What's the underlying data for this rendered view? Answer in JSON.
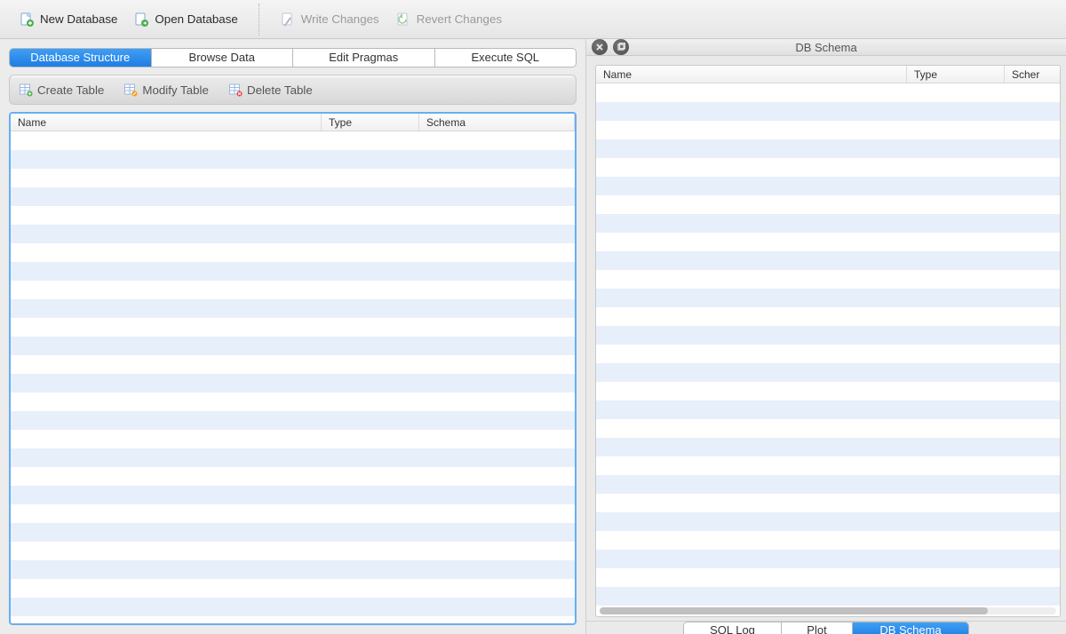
{
  "toolbar": {
    "new_database": "New Database",
    "open_database": "Open Database",
    "write_changes": "Write Changes",
    "revert_changes": "Revert Changes"
  },
  "tabs": {
    "structure": "Database Structure",
    "browse": "Browse Data",
    "pragmas": "Edit Pragmas",
    "execute": "Execute SQL"
  },
  "actions": {
    "create_table": "Create Table",
    "modify_table": "Modify Table",
    "delete_table": "Delete Table"
  },
  "columns": {
    "name": "Name",
    "type": "Type",
    "schema": "Schema"
  },
  "right_panel": {
    "title": "DB Schema",
    "columns": {
      "name": "Name",
      "type": "Type",
      "schema": "Scher"
    }
  },
  "bottom_tabs": {
    "sql_log": "SQL Log",
    "plot": "Plot",
    "db_schema": "DB Schema"
  }
}
